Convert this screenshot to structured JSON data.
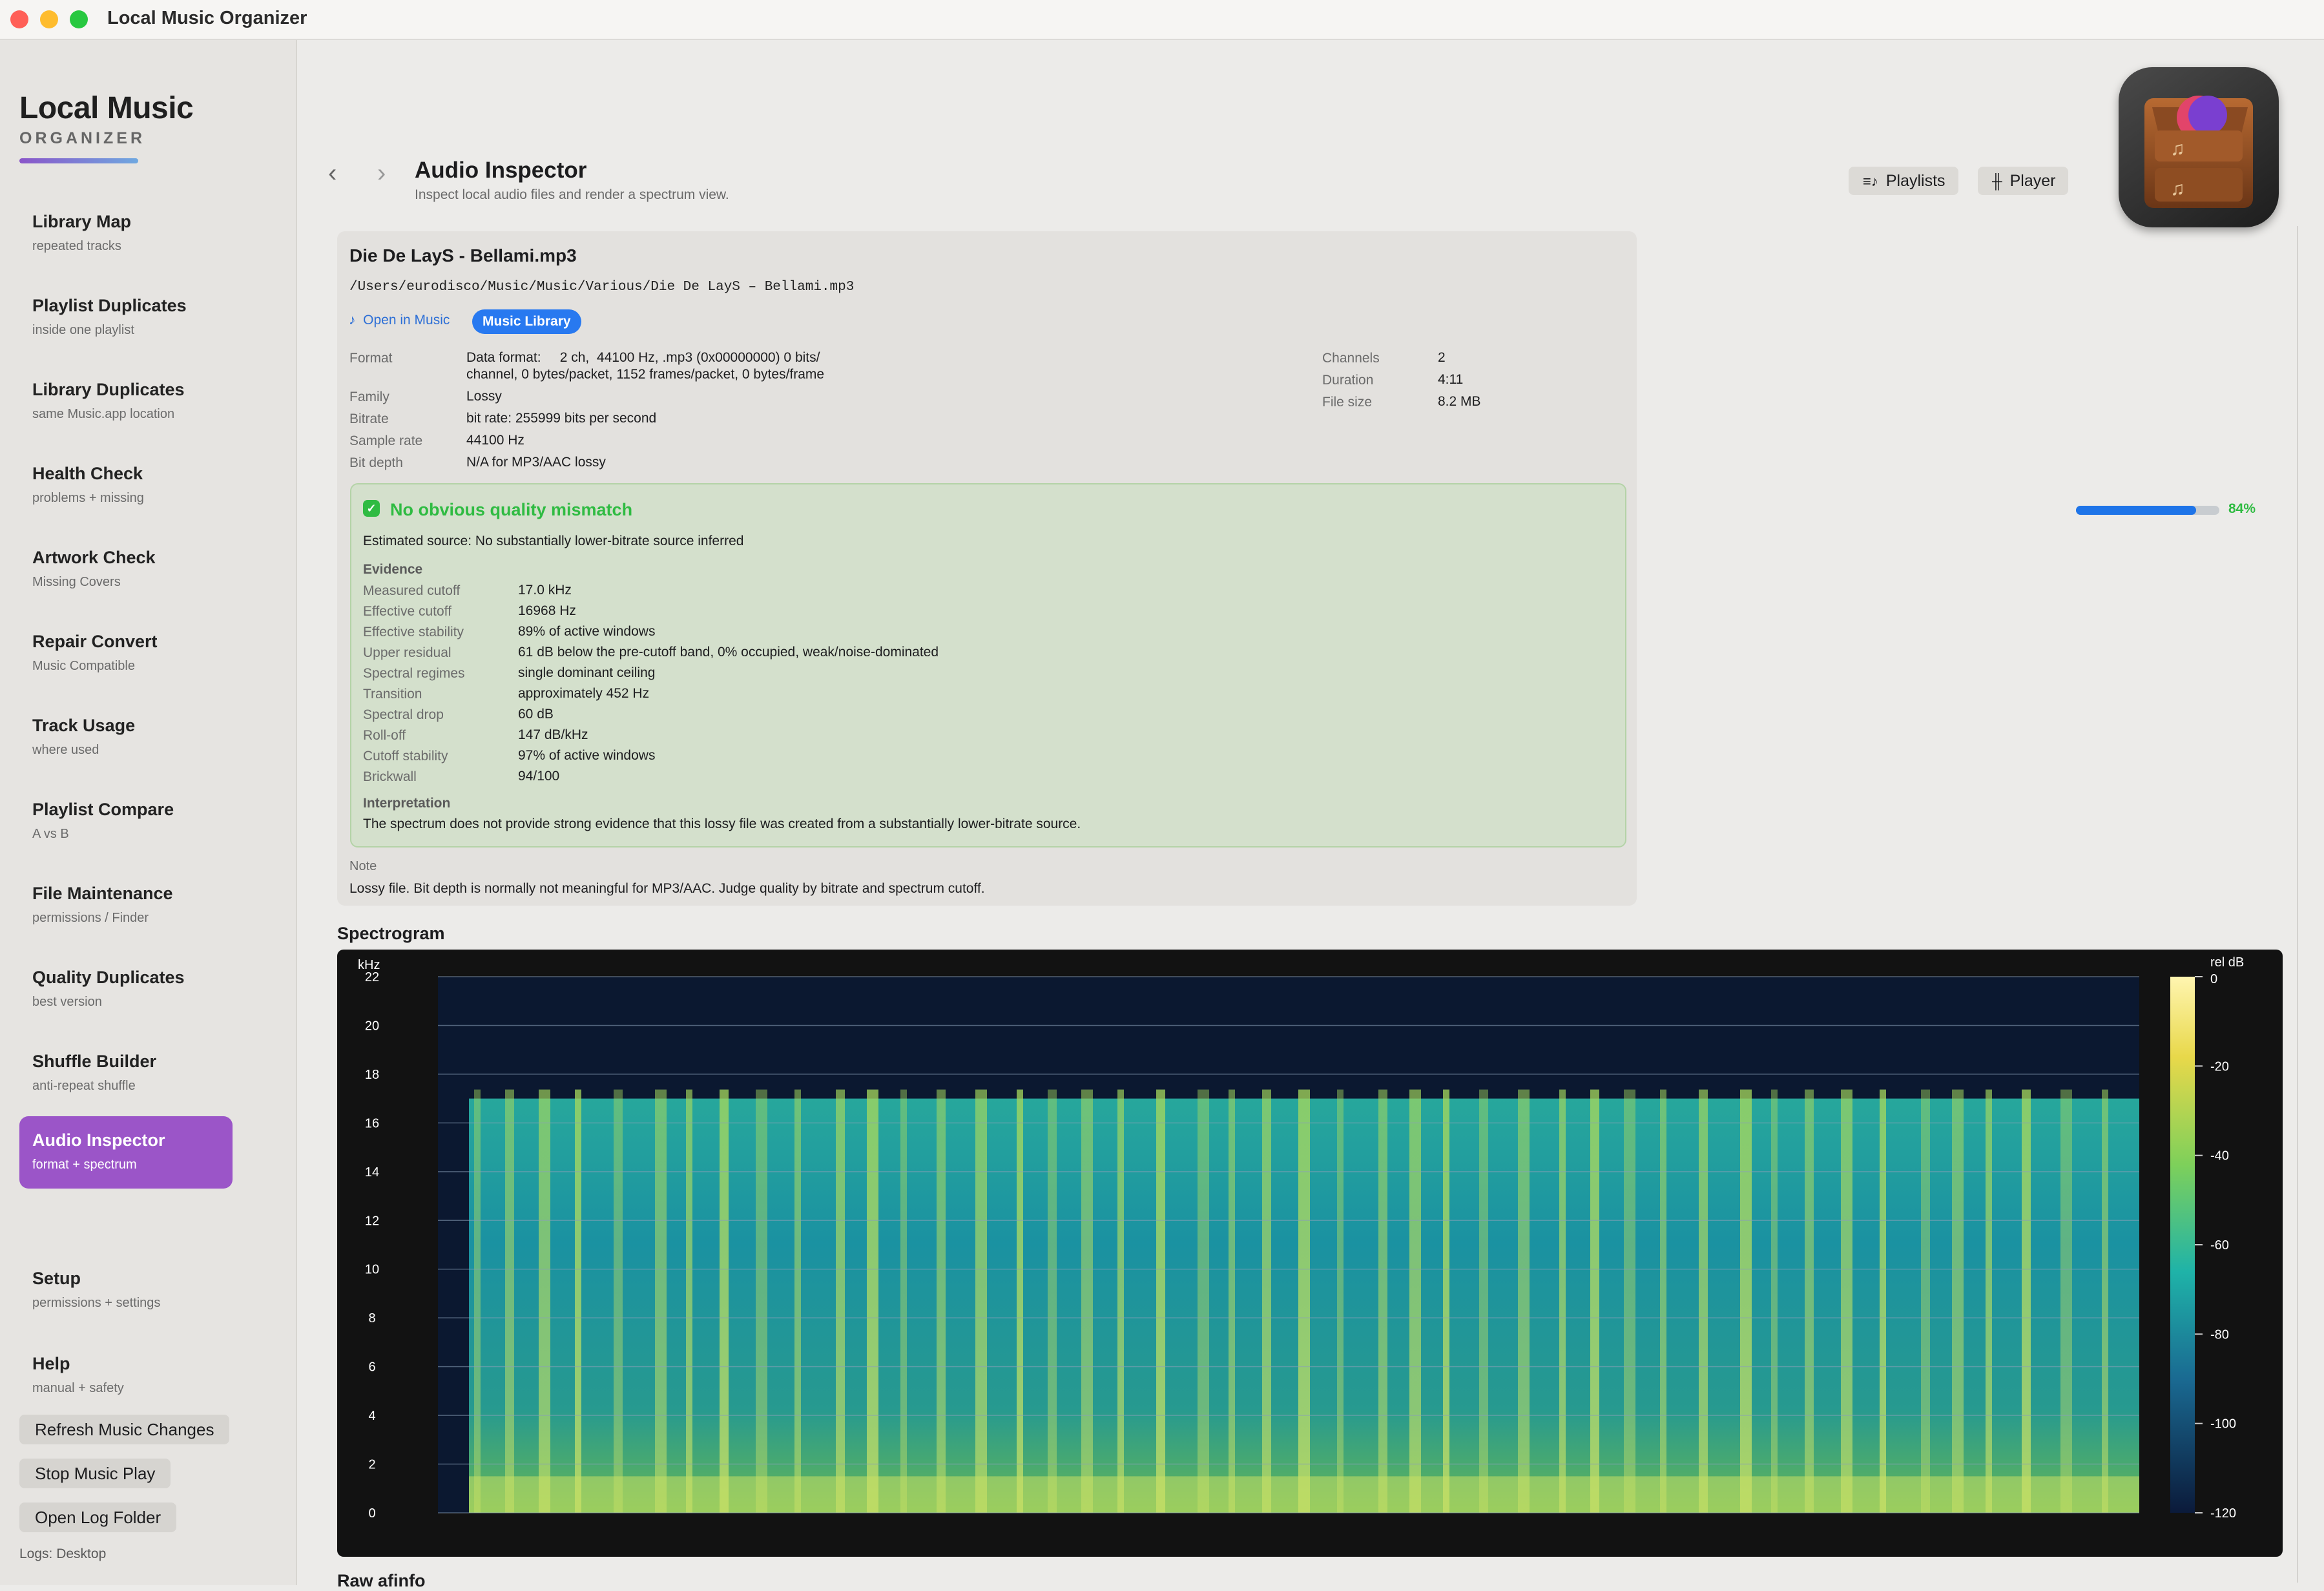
{
  "window": {
    "title": "Local Music Organizer"
  },
  "brand": {
    "title": "Local Music",
    "subtitle": "ORGANIZER"
  },
  "sidebar": {
    "items": [
      {
        "title": "Library Map",
        "subtitle": "repeated tracks"
      },
      {
        "title": "Playlist Duplicates",
        "subtitle": "inside one playlist"
      },
      {
        "title": "Library Duplicates",
        "subtitle": "same Music.app location"
      },
      {
        "title": "Health Check",
        "subtitle": "problems + missing"
      },
      {
        "title": "Artwork Check",
        "subtitle": "Missing Covers"
      },
      {
        "title": "Repair Convert",
        "subtitle": "Music Compatible"
      },
      {
        "title": "Track Usage",
        "subtitle": "where used"
      },
      {
        "title": "Playlist Compare",
        "subtitle": "A vs B"
      },
      {
        "title": "File Maintenance",
        "subtitle": "permissions / Finder"
      },
      {
        "title": "Quality Duplicates",
        "subtitle": "best version"
      },
      {
        "title": "Shuffle Builder",
        "subtitle": "anti-repeat shuffle"
      },
      {
        "title": "Audio Inspector",
        "subtitle": "format + spectrum"
      },
      {
        "title": "Setup",
        "subtitle": "permissions + settings"
      },
      {
        "title": "Help",
        "subtitle": "manual + safety"
      }
    ],
    "active": "Audio Inspector",
    "buttons": {
      "refresh": "Refresh Music Changes",
      "stop": "Stop Music Play",
      "open_log": "Open Log Folder"
    },
    "logs_label": "Logs: Desktop"
  },
  "header": {
    "title": "Audio Inspector",
    "subtitle": "Inspect local audio files and render a spectrum view.",
    "playlists_button": "Playlists",
    "player_button": "Player",
    "back_icon": "chevron-left-icon",
    "forward_icon": "chevron-right-icon"
  },
  "file": {
    "title": "Die De LayS - Bellami.mp3",
    "path": "/Users/eurodisco/Music/Music/Various/Die De LayS – Bellami.mp3",
    "open_in_music": "Open in Music",
    "library_badge": "Music Library"
  },
  "details_left": [
    {
      "label": "Format",
      "value": "Data format:     2 ch,  44100 Hz, .mp3 (0x00000000) 0 bits/",
      "value2": "channel, 0 bytes/packet, 1152 frames/packet, 0 bytes/frame"
    },
    {
      "label": "Family",
      "value": "Lossy"
    },
    {
      "label": "Bitrate",
      "value": "bit rate: 255999 bits per second"
    },
    {
      "label": "Sample rate",
      "value": "44100 Hz"
    },
    {
      "label": "Bit depth",
      "value": "N/A for MP3/AAC lossy"
    }
  ],
  "details_right": [
    {
      "label": "Channels",
      "value": "2"
    },
    {
      "label": "Duration",
      "value": "4:11"
    },
    {
      "label": "File size",
      "value": "8.2 MB"
    }
  ],
  "quality": {
    "title": "No obvious quality mismatch",
    "confidence_label": "84%",
    "confidence": 0.84,
    "estimated_source": "Estimated source: No substantially lower-bitrate source inferred",
    "evidence_heading": "Evidence",
    "evidence": [
      {
        "label": "Measured cutoff",
        "value": "17.0 kHz"
      },
      {
        "label": "Effective cutoff",
        "value": "16968 Hz"
      },
      {
        "label": "Effective stability",
        "value": "89% of active windows"
      },
      {
        "label": "Upper residual",
        "value": "61 dB below the pre-cutoff band, 0% occupied, weak/noise-dominated"
      },
      {
        "label": "Spectral regimes",
        "value": "single dominant ceiling"
      },
      {
        "label": "Transition",
        "value": "approximately 452 Hz"
      },
      {
        "label": "Spectral drop",
        "value": "60 dB"
      },
      {
        "label": "Roll-off",
        "value": "147 dB/kHz"
      },
      {
        "label": "Cutoff stability",
        "value": "97% of active windows"
      },
      {
        "label": "Brickwall",
        "value": "94/100"
      }
    ],
    "interpretation_heading": "Interpretation",
    "interpretation": "The spectrum does not provide strong evidence that this lossy file was created from a substantially lower-bitrate source."
  },
  "note": {
    "label": "Note",
    "text": "Lossy file. Bit depth is normally not meaningful for MP3/AAC. Judge quality by bitrate and spectrum cutoff."
  },
  "spectrogram": {
    "heading": "Spectrogram",
    "y_unit": "kHz",
    "y_ticks": [
      "22",
      "20",
      "18",
      "16",
      "14",
      "12",
      "10",
      "8",
      "6",
      "4",
      "2",
      "0"
    ],
    "colorbar_title": "rel dB",
    "colorbar_ticks": [
      "0",
      "-20",
      "-40",
      "-60",
      "-80",
      "-100",
      "-120"
    ],
    "cutoff_khz": 17.0,
    "colors": {
      "low": "#0b1a3a",
      "mid": "#1aa9b5",
      "high": "#7ed05a",
      "peak": "#f4e06a"
    }
  },
  "raw_heading": "Raw afinfo"
}
